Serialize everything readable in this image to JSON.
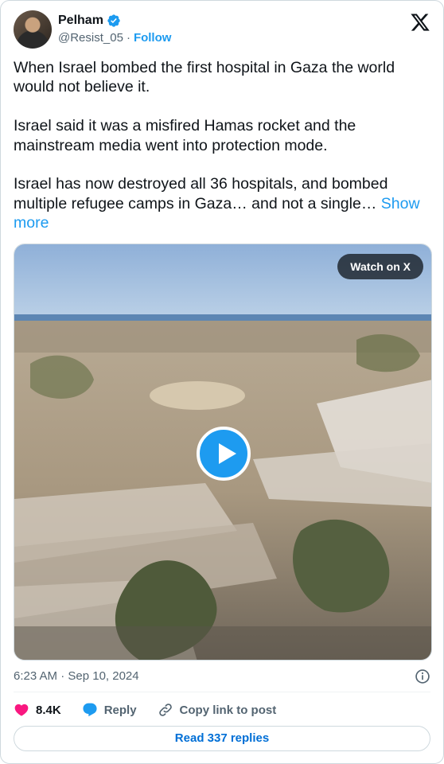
{
  "author": {
    "name": "Pelham",
    "handle": "@Resist_05",
    "separator": "·",
    "follow_label": "Follow",
    "verified": true
  },
  "tweet": {
    "text": "When Israel bombed the first hospital in Gaza the world would not believe it.\n\nIsrael said it was a misfired Hamas rocket and the mainstream media went into protection mode.\n\nIsrael has now destroyed all 36 hospitals, and bombed multiple refugee camps in Gaza… and not a single… ",
    "show_more_label": "Show more"
  },
  "media": {
    "watch_label": "Watch on X"
  },
  "meta": {
    "timestamp": "6:23 AM · Sep 10, 2024"
  },
  "actions": {
    "likes": "8.4K",
    "reply_label": "Reply",
    "copy_label": "Copy link to post"
  },
  "read_replies_label": "Read 337 replies",
  "colors": {
    "accent": "#1d9bf0",
    "like": "#f91880",
    "text": "#0f1419",
    "muted": "#536471"
  }
}
